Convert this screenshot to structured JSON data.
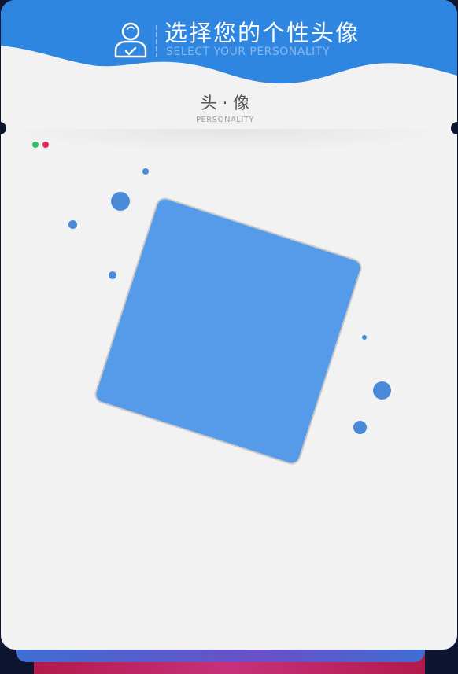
{
  "header": {
    "title": "选择您的个性头像",
    "subtitle": "SELECT YOUR PERSONALITY",
    "icon": "user-check-icon"
  },
  "section": {
    "title": "头 · 像",
    "subtitle": "PERSONALITY"
  },
  "status_dots": [
    "green",
    "red"
  ],
  "colors": {
    "accent": "#2f86e0",
    "avatar_fill": "#569be9",
    "dot": "#4a8ad8",
    "card_bg": "#f2f2f2",
    "status_green": "#2ec06a",
    "status_red": "#e8245a"
  }
}
